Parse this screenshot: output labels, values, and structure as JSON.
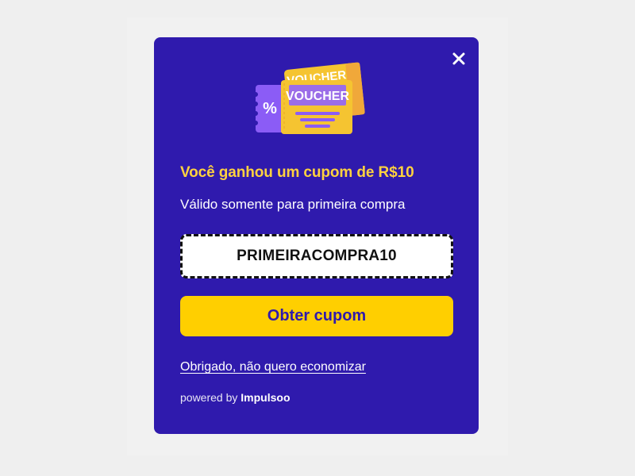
{
  "popup": {
    "illustration": {
      "icon": "voucher-tickets-icon",
      "back_ticket_label": "VOUCHER",
      "front_ticket_label": "VOUCHER",
      "stub_symbol": "%"
    },
    "close_icon": "close-icon",
    "title": "Você ganhou um cupom de R$10",
    "subtitle": "Válido somente para primeira compra",
    "coupon_code": "PRIMEIRACOMPRA10",
    "cta_label": "Obter cupom",
    "decline_label": "Obrigado, não quero economizar",
    "powered_by_prefix": "powered by",
    "powered_by_brand": "Impulsoo"
  },
  "colors": {
    "modal_background": "#2f1aad",
    "title": "#ffd23f",
    "cta_background": "#ffcf00",
    "cta_text": "#2f1aad",
    "ticket_purple": "#8b5cf6",
    "ticket_yellow": "#f5c431",
    "page_background": "#efefef"
  }
}
